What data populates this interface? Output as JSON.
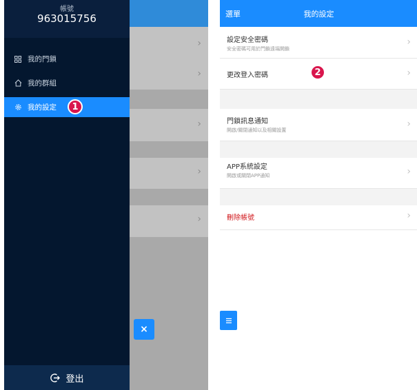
{
  "left_screen": {
    "account": {
      "label": "帳號",
      "number": "963015756"
    },
    "menu": [
      {
        "label": "我的門鎖",
        "icon": "grid-icon"
      },
      {
        "label": "我的群組",
        "icon": "home-icon"
      },
      {
        "label": "我的設定",
        "icon": "gear-icon",
        "active": true
      }
    ],
    "badge": "1",
    "close_icon": "×",
    "logout": {
      "label": "登出",
      "icon": "logout-icon"
    }
  },
  "right_screen": {
    "header": {
      "menu_label": "選單",
      "title": "我的設定"
    },
    "rows": [
      {
        "title": "設定安全密碼",
        "subtitle": "安全密碼可用於門鎖遠端開鎖"
      },
      {
        "title": "更改登入密碼",
        "subtitle": ""
      },
      {
        "title": "門鎖訊息通知",
        "subtitle": "開啟/關閉通知以及相關設置"
      },
      {
        "title": "APP系統設定",
        "subtitle": "開啟或關閉APP通知"
      },
      {
        "title": "刪除帳號",
        "subtitle": ""
      }
    ],
    "badge": "2",
    "chevron": "›",
    "fab_icon": "menu-icon"
  },
  "colors": {
    "accent_blue": "#1a8cff",
    "drawer_bg": "#04172f",
    "badge": "#d9164d",
    "danger": "#d0161a"
  }
}
